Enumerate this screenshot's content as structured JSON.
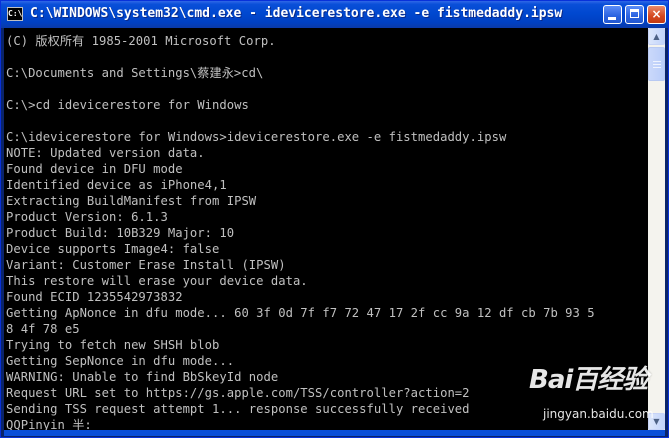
{
  "window": {
    "title": "C:\\WINDOWS\\system32\\cmd.exe - idevicerestore.exe -e fistmedaddy.ipsw",
    "icon_text": "C:\\",
    "buttons": {
      "minimize": "minimize-icon",
      "maximize": "maximize-icon",
      "close": "×"
    }
  },
  "console": {
    "background": "#000000",
    "foreground": "#c0c0c0",
    "lines": [
      "(C) 版权所有 1985-2001 Microsoft Corp.",
      "",
      "C:\\Documents and Settings\\蔡建永>cd\\",
      "",
      "C:\\>cd idevicerestore for Windows",
      "",
      "C:\\idevicerestore for Windows>idevicerestore.exe -e fistmedaddy.ipsw",
      "NOTE: Updated version data.",
      "Found device in DFU mode",
      "Identified device as iPhone4,1",
      "Extracting BuildManifest from IPSW",
      "Product Version: 6.1.3",
      "Product Build: 10B329 Major: 10",
      "Device supports Image4: false",
      "Variant: Customer Erase Install (IPSW)",
      "This restore will erase your device data.",
      "Found ECID 1235542973832",
      "Getting ApNonce in dfu mode... 60 3f 0d 7f f7 72 47 17 2f cc 9a 12 df cb 7b 93 5",
      "8 4f 78 e5",
      "Trying to fetch new SHSH blob",
      "Getting SepNonce in dfu mode...",
      "WARNING: Unable to find BbSkeyId node",
      "Request URL set to https://gs.apple.com/TSS/controller?action=2",
      "Sending TSS request attempt 1... response successfully received",
      "QQPinyin 半:"
    ]
  },
  "scrollbar": {
    "up_arrow": "▲",
    "down_arrow": "▼"
  },
  "watermark": {
    "logo": "Bai百经验",
    "url": "jingyan.baidu.com"
  }
}
